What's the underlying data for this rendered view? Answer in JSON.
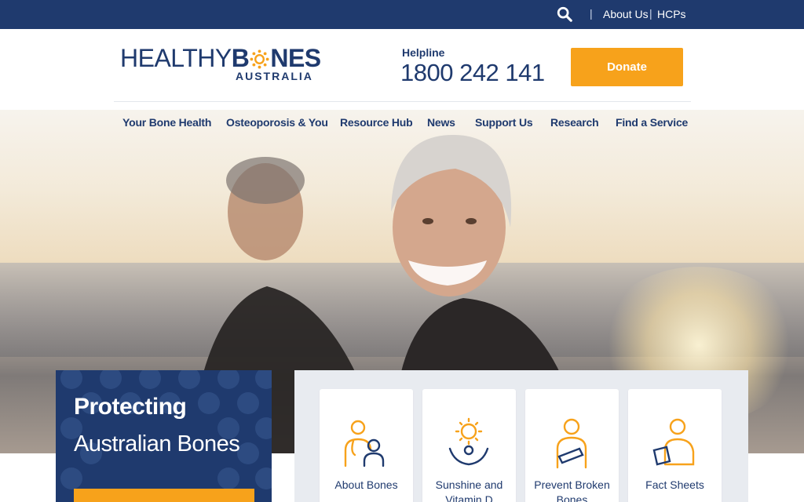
{
  "topbar": {
    "search_icon": "search-icon",
    "links": [
      {
        "label": "About Us"
      },
      {
        "label": "HCPs"
      }
    ]
  },
  "brand": {
    "name_part1": "HEALTHY",
    "name_part2_pre": "B",
    "name_part2_post": "NES",
    "name_line2": "AUSTRALIA",
    "colors": {
      "navy": "#1f3a6e",
      "orange": "#f7a21b"
    }
  },
  "helpline": {
    "label": "Helpline",
    "number": "1800 242 141"
  },
  "donate": {
    "label": "Donate"
  },
  "nav": {
    "items": [
      {
        "label": "Your Bone Health"
      },
      {
        "label": "Osteoporosis & You"
      },
      {
        "label": "Resource Hub"
      },
      {
        "label": "News"
      },
      {
        "label": "Support Us"
      },
      {
        "label": "Research"
      },
      {
        "label": "Find a Service"
      }
    ]
  },
  "promo": {
    "line1": "Protecting",
    "line2": "Australian Bones"
  },
  "quick_links": [
    {
      "label": "About Bones",
      "icon": "doctor-patient-icon"
    },
    {
      "label": "Sunshine and Vitamin D",
      "icon": "sun-person-icon"
    },
    {
      "label": "Prevent Broken Bones",
      "icon": "arm-sling-icon"
    },
    {
      "label": "Fact Sheets",
      "icon": "person-reading-icon"
    }
  ]
}
